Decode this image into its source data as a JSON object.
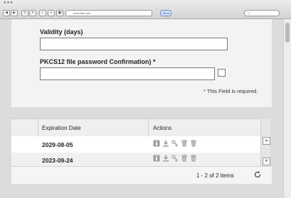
{
  "browser": {
    "url_text": "www.site.com",
    "go_label": "Go ▾",
    "search_placeholder": "Q"
  },
  "form": {
    "validity_label": "Validity (days)",
    "validity_value": "",
    "password_confirm_label": "PKCS12 file password Confirmation) *",
    "password_confirm_value": "",
    "required_note": "* This Field is required."
  },
  "grid": {
    "columns": [
      "Expiration Date",
      "Actions"
    ],
    "rows": [
      {
        "expiration_date": "2029-08-05"
      },
      {
        "expiration_date": "2023-09-24"
      }
    ],
    "pagination": "1 - 2 of 2 items"
  }
}
